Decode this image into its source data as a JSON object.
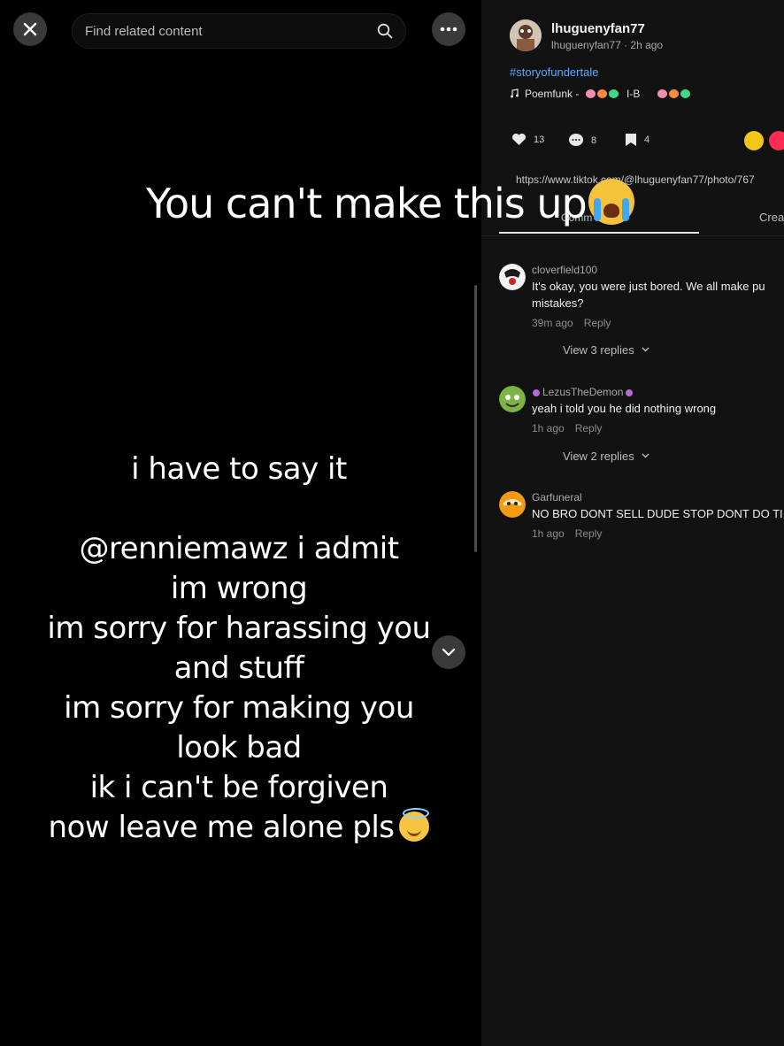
{
  "viewer": {
    "search_placeholder": "Find related content",
    "post_lines_top": "i have to say it",
    "post_lines": [
      "@renniemawz i admit",
      "im wrong",
      "im sorry for harassing you",
      "and stuff",
      "im sorry for making you",
      "look bad",
      "ik i can't be forgiven",
      "now leave me alone pls"
    ]
  },
  "caption": {
    "text": "You can't make this up"
  },
  "panel": {
    "author_name": "lhuguenyfan77",
    "author_meta": "lhuguenyfan77 · 2h ago",
    "hashtag": "#storyofundertale",
    "music": "Poemfunk -",
    "music_suffix": "I-B",
    "likes": "13",
    "comments_count": "8",
    "saves": "4",
    "url": "https://www.tiktok.com/@lhuguenyfan77/photo/767",
    "tab_left": "Comm",
    "tab_right": "Crea"
  },
  "comments": [
    {
      "user": "cloverfield100",
      "text": "It's okay, you were just bored. We all make pu mistakes?",
      "time": "39m ago",
      "reply": "Reply",
      "view_replies": "View 3 replies"
    },
    {
      "user": "LezusTheDemon",
      "text": "yeah i told you he did nothing wrong",
      "time": "1h ago",
      "reply": "Reply",
      "view_replies": "View 2 replies"
    },
    {
      "user": "Garfuneral",
      "text": "NO BRO DONT SELL DUDE STOP DONT DO TI",
      "time": "1h ago",
      "reply": "Reply"
    }
  ],
  "colors": {
    "hashtag": "#5ea8ff",
    "panel_bg": "#121212",
    "badge_yellow": "#f5c518",
    "badge_red": "#fe2c55"
  }
}
